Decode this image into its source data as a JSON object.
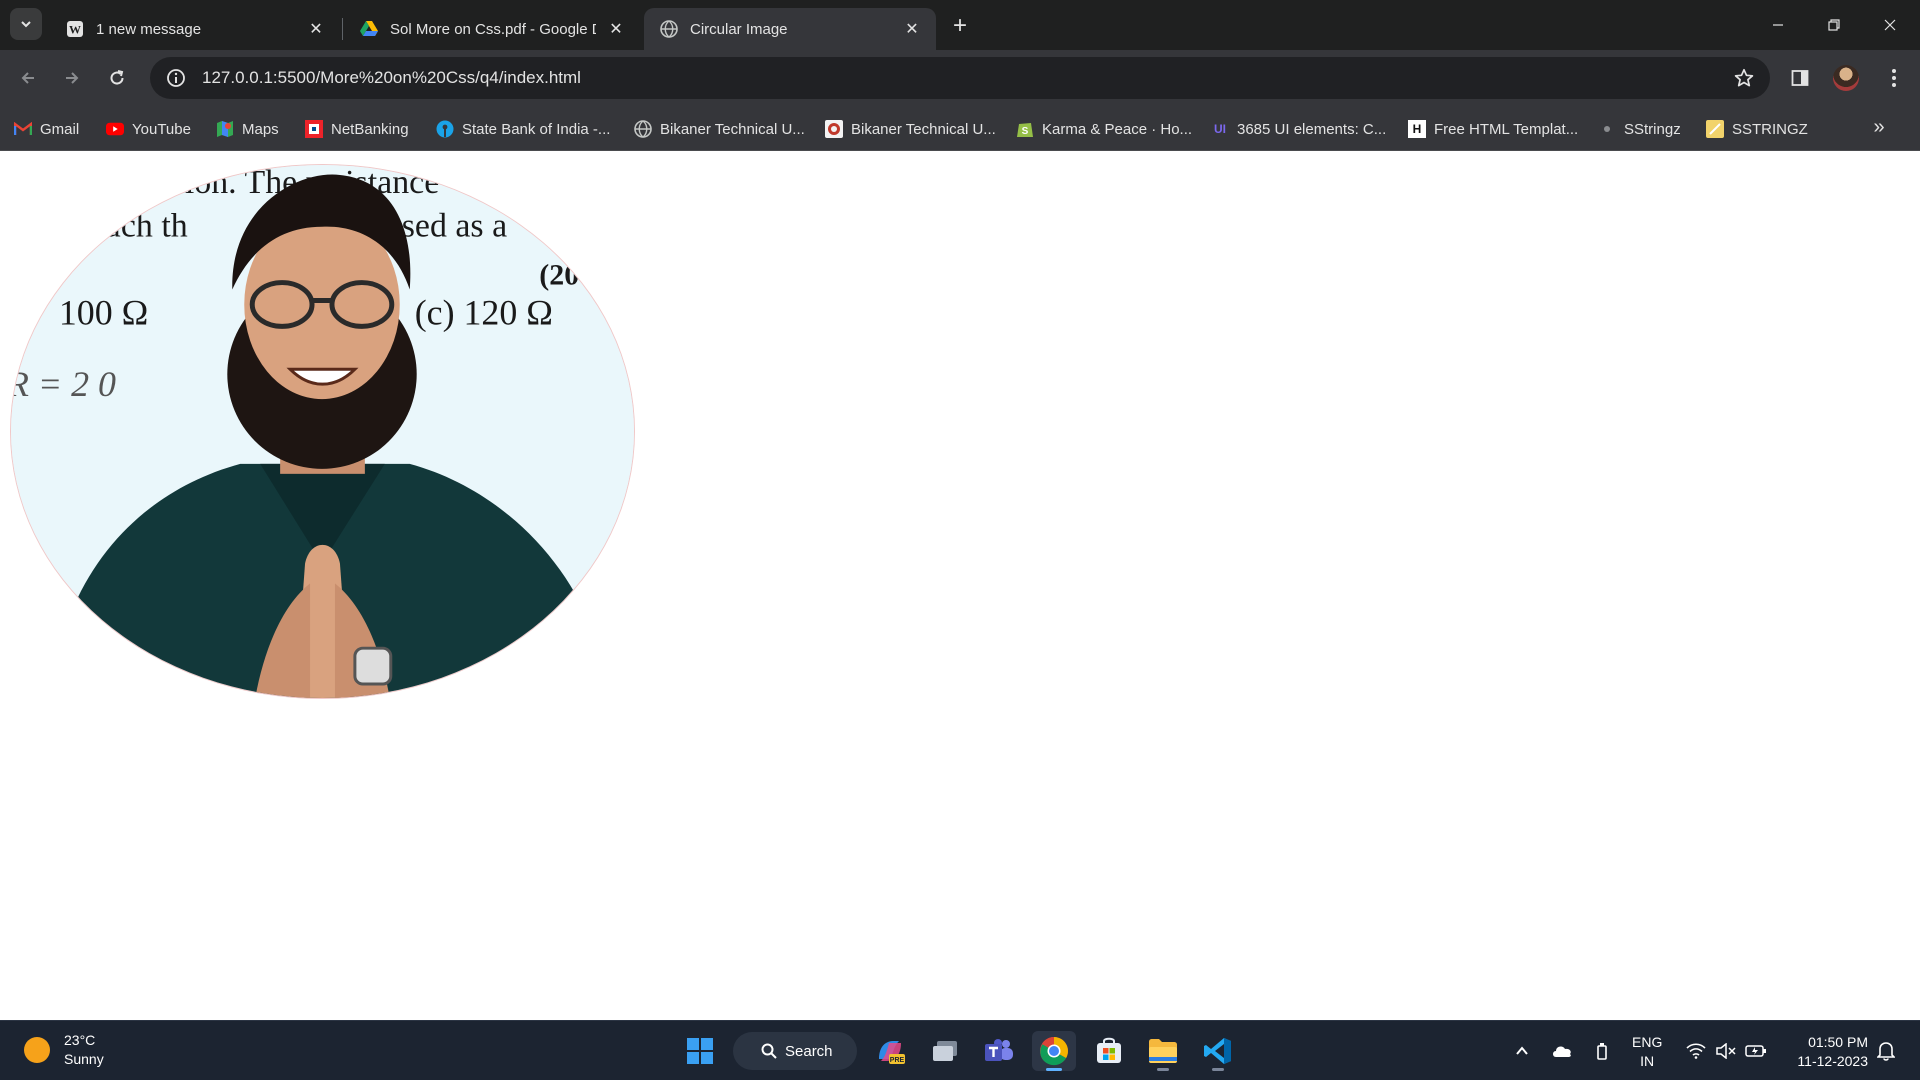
{
  "browser": {
    "tabs": [
      {
        "title": "1 new message",
        "icon": "wordpress-icon",
        "active": false
      },
      {
        "title": "Sol More on Css.pdf - Google D",
        "icon": "google-drive-icon",
        "active": false
      },
      {
        "title": "Circular Image",
        "icon": "globe-icon",
        "active": true
      }
    ],
    "close_glyph": "✕",
    "new_tab_glyph": "+",
    "address": "127.0.0.1:5500/More%20on%20Css/q4/index.html",
    "bookmarks": [
      {
        "label": "Gmail",
        "icon": "gmail-icon"
      },
      {
        "label": "YouTube",
        "icon": "youtube-icon"
      },
      {
        "label": "Maps",
        "icon": "maps-icon"
      },
      {
        "label": "NetBanking",
        "icon": "hdfc-icon"
      },
      {
        "label": "State Bank of India -...",
        "icon": "sbi-icon"
      },
      {
        "label": "Bikaner Technical U...",
        "icon": "globe-icon"
      },
      {
        "label": "Bikaner Technical U...",
        "icon": "btu-icon"
      },
      {
        "label": "Karma & Peace · Ho...",
        "icon": "shopify-icon"
      },
      {
        "label": "3685 UI elements: C...",
        "icon": "uiverse-icon"
      },
      {
        "label": "Free HTML Templat...",
        "icon": "h-icon"
      },
      {
        "label": "SStringz",
        "icon": "dot-icon"
      },
      {
        "label": "SSTRINGZ",
        "icon": "sstringz-icon"
      }
    ],
    "bookmark_icon_letters": {
      "uiverse": "UI",
      "h": "H",
      "shopify": "S"
    },
    "more_bookmarks_glyph": "»"
  },
  "page": {
    "image": {
      "shape": "circle",
      "board_text": [
        "tion. The resistance",
        "such th",
        "used as a",
        "(20",
        "100 Ω",
        "(c)  120 Ω",
        "R = 2 0"
      ]
    }
  },
  "taskbar": {
    "weather": {
      "temp": "23°C",
      "condition": "Sunny"
    },
    "search_label": "Search",
    "apps": [
      "windows-start",
      "copilot",
      "task-view",
      "teams",
      "chrome",
      "microsoft-store",
      "file-explorer",
      "vscode"
    ],
    "copilot_badge": "PRE",
    "language": {
      "line1": "ENG",
      "line2": "IN"
    },
    "time": "01:50 PM",
    "date": "11-12-2023"
  },
  "colors": {
    "tabstrip": "#1f2020",
    "toolbar": "#35363a",
    "omnibox": "#202124",
    "taskbar": "#1c2431",
    "accent": "#5fb2ff"
  }
}
